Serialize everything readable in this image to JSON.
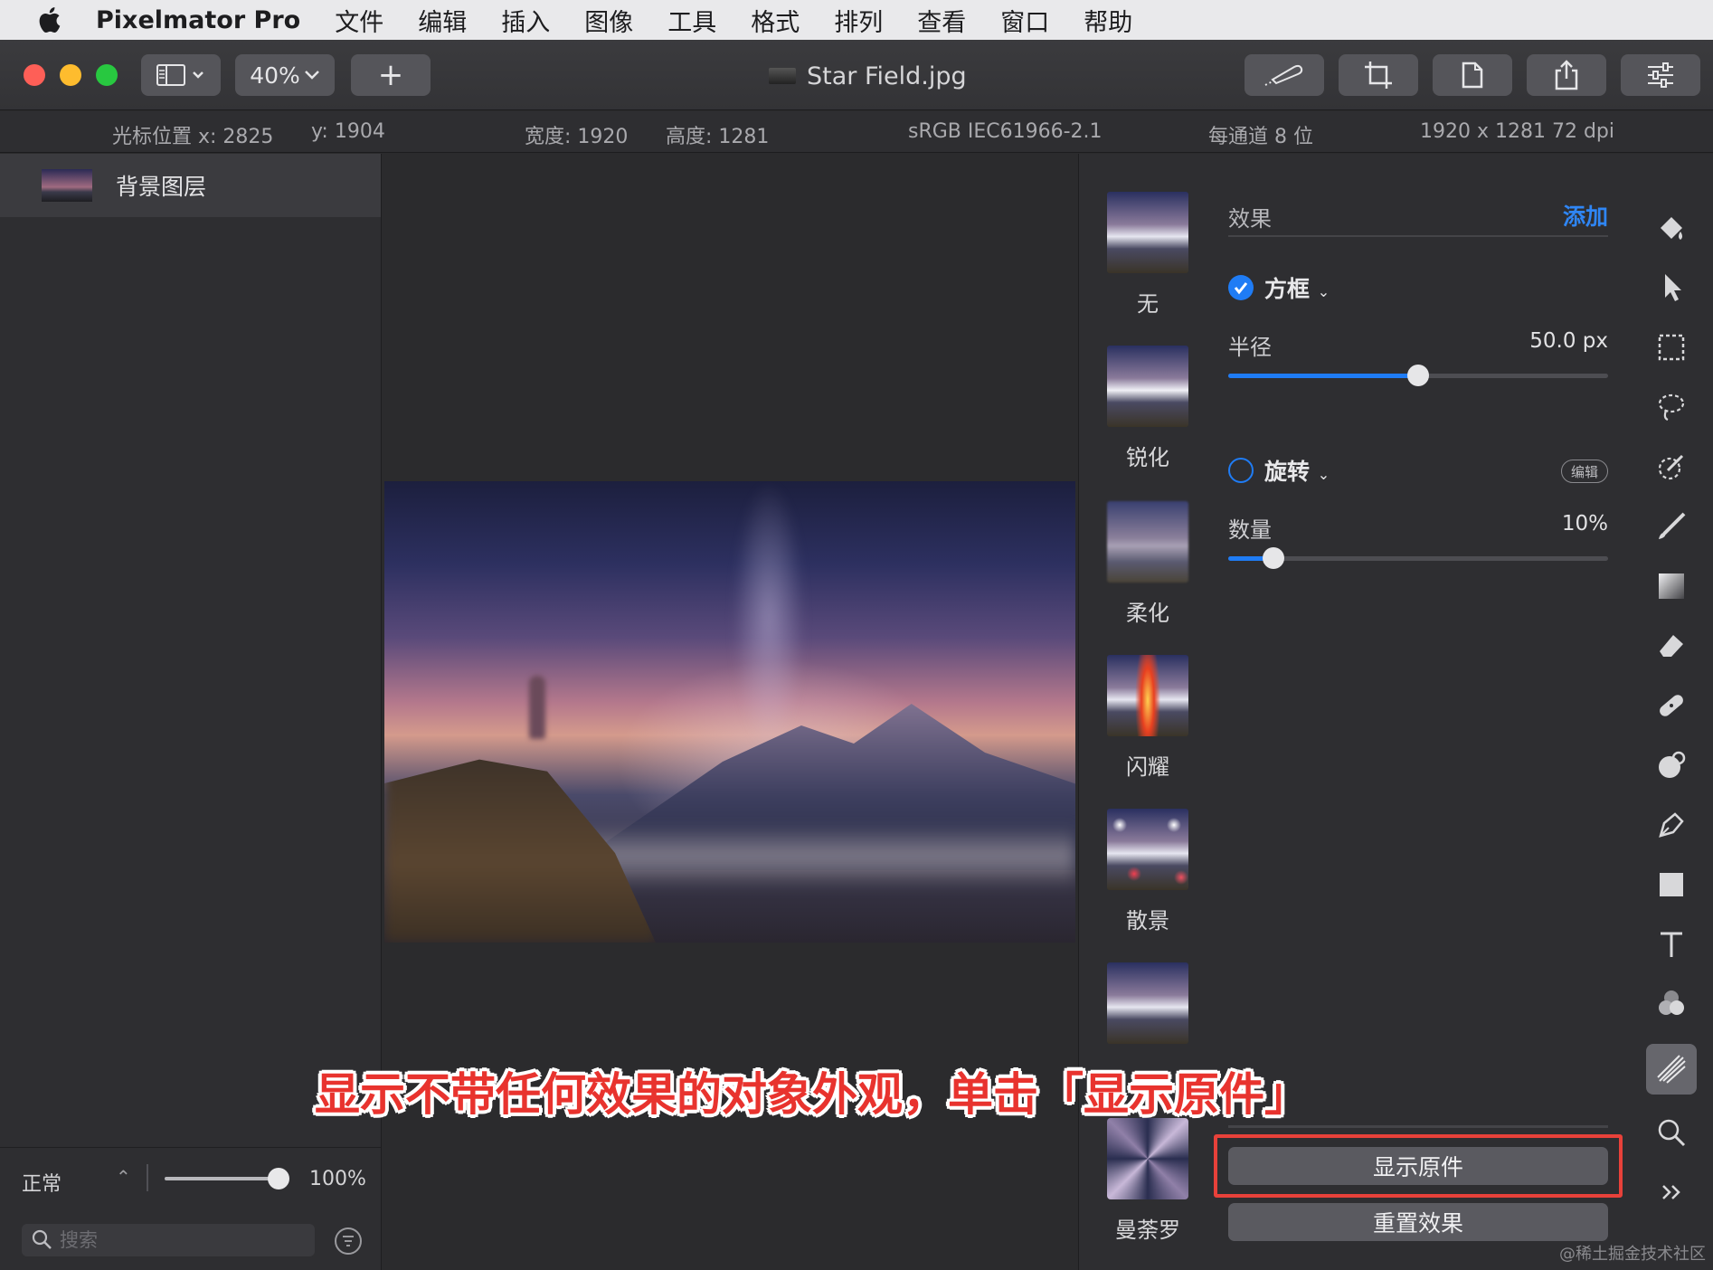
{
  "menubar": {
    "app_name": "Pixelmator Pro",
    "items": [
      "文件",
      "编辑",
      "插入",
      "图像",
      "工具",
      "格式",
      "排列",
      "查看",
      "窗口",
      "帮助"
    ]
  },
  "toolbar": {
    "zoom": "40%",
    "add_symbol": "+",
    "document_title": "Star Field.jpg"
  },
  "infobar": {
    "cursor_x": "光标位置 x:  2825",
    "cursor_y": "y:  1904",
    "width": "宽度:  1920",
    "height": "高度:  1281",
    "color_profile": "sRGB IEC61966-2.1",
    "bit_depth": "每通道 8 位",
    "dimensions": "1920 x 1281 72 dpi"
  },
  "layers": {
    "items": [
      {
        "name": "背景图层"
      }
    ],
    "blend_mode": "正常",
    "opacity": "100%",
    "opacity_fraction": 1.0,
    "search_placeholder": "搜索"
  },
  "effects_browser": {
    "items": [
      {
        "label": "无",
        "icon": "none-effect-thumb"
      },
      {
        "label": "锐化",
        "icon": "sharpen-effect-thumb"
      },
      {
        "label": "柔化",
        "icon": "soften-effect-thumb"
      },
      {
        "label": "闪耀",
        "icon": "glow-effect-thumb"
      },
      {
        "label": "散景",
        "icon": "bokeh-effect-thumb"
      },
      {
        "label": "",
        "icon": "effect-thumb"
      },
      {
        "label": "曼荼罗",
        "icon": "mandala-effect-thumb"
      }
    ]
  },
  "effects_panel": {
    "title": "效果",
    "add_label": "添加",
    "box": {
      "name": "方框",
      "enabled": true,
      "radius_label": "半径",
      "radius_value": "50.0 px",
      "radius_fraction": 0.5
    },
    "rotate": {
      "name": "旋转",
      "enabled": false,
      "edit_label": "编辑",
      "amount_label": "数量",
      "amount_value": "10%",
      "amount_fraction": 0.12
    },
    "show_original_label": "显示原件",
    "reset_label": "重置效果"
  },
  "tools": [
    "paint-bucket-icon",
    "arrow-pointer-icon",
    "marquee-select-icon",
    "lasso-select-icon",
    "quick-select-icon",
    "paint-brush-icon",
    "gradient-icon",
    "eraser-icon",
    "bandage-repair-icon",
    "clone-icon",
    "pen-icon",
    "shape-icon",
    "type-icon",
    "color-adjust-icon",
    "effects-icon",
    "zoom-icon",
    "more-icon"
  ],
  "caption": "显示不带任何效果的对象外观，单击「显示原件」",
  "watermark": "@稀土掘金技术社区",
  "colors": {
    "accent": "#1f7cf5",
    "highlight": "#e8413a",
    "caption": "#e8332e"
  }
}
